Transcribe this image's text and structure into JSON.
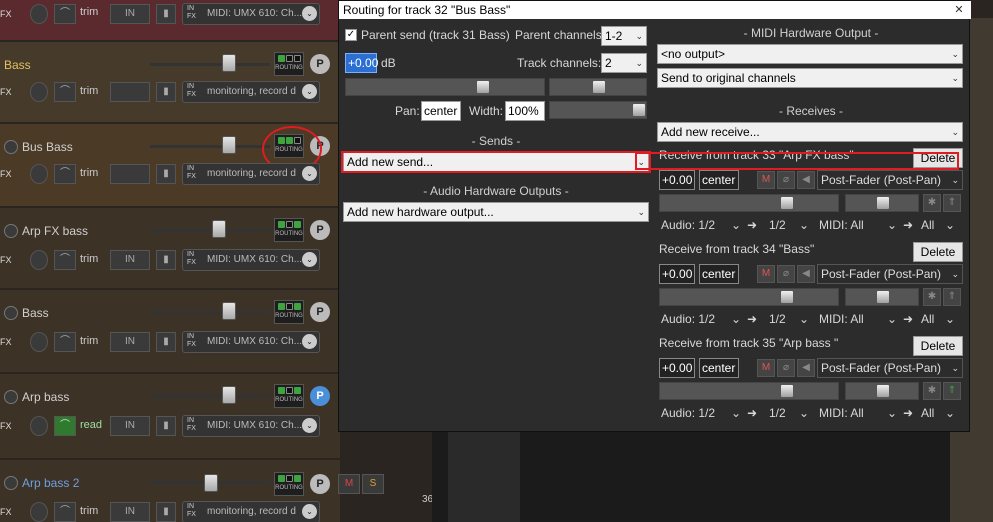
{
  "tracks": [
    {
      "name": "",
      "fx": "FX",
      "trim": "trim",
      "in": "IN",
      "midi": "MIDI: UMX 610: Ch..."
    },
    {
      "name": "Bass",
      "fx": "FX",
      "trim": "trim",
      "in": "IN",
      "midi": "monitoring, record d"
    },
    {
      "name": "Bus Bass",
      "fx": "FX",
      "trim": "trim",
      "in": "IN",
      "midi": "monitoring, record d"
    },
    {
      "name": "Arp FX bass",
      "fx": "FX",
      "trim": "trim",
      "in": "IN",
      "midi": "MIDI: UMX 610: Ch..."
    },
    {
      "name": "Bass",
      "fx": "FX",
      "trim": "trim",
      "in": "IN",
      "midi": "MIDI: UMX 610: Ch..."
    },
    {
      "name": "Arp bass",
      "fx": "FX",
      "trim": "read",
      "in": "IN",
      "midi": "MIDI: UMX 610: Ch..."
    },
    {
      "name": "Arp bass 2",
      "fx": "FX",
      "trim": "trim",
      "in": "IN",
      "midi": "monitoring, record d"
    }
  ],
  "common": {
    "routing": "ROUTING",
    "p": "P",
    "in_fx": "IN\nFX",
    "m": "M",
    "s": "S",
    "track_number": "36"
  },
  "dialog": {
    "title": "Routing for track 32 \"Bus Bass\"",
    "close": "✕",
    "parent_send_label": "Parent send (track 31 Bass)",
    "parent_channels_label": "Parent channels:",
    "parent_channels_value": "1-2",
    "volume_value": "+0.00",
    "db_label": "dB",
    "track_channels_label": "Track channels:",
    "track_channels_value": "2",
    "pan_label": "Pan:",
    "pan_value": "center",
    "width_label": "Width:",
    "width_value": "100%",
    "sends_header": "- Sends -",
    "add_new_send": "Add new send...",
    "audio_hw_header": "- Audio Hardware Outputs -",
    "add_new_hw": "Add new hardware output...",
    "midi_hw_header": "- MIDI Hardware Output -",
    "midi_output": "<no output>",
    "midi_channels": "Send to original channels",
    "receives_header": "- Receives -",
    "add_new_receive": "Add new receive...",
    "receives": [
      {
        "label": "Receive from track 33 \"Arp FX bass\"",
        "volume": "+0.00",
        "pan": "center",
        "mode": "Post-Fader (Post-Pan)",
        "audio": "Audio: 1/2",
        "audio_dest": "1/2",
        "midi": "MIDI: All",
        "midi_dest": "All",
        "delete": "Delete"
      },
      {
        "label": "Receive from track 34 \"Bass\"",
        "volume": "+0.00",
        "pan": "center",
        "mode": "Post-Fader (Post-Pan)",
        "audio": "Audio: 1/2",
        "audio_dest": "1/2",
        "midi": "MIDI: All",
        "midi_dest": "All",
        "delete": "Delete"
      },
      {
        "label": "Receive from track 35 \"Arp bass \"",
        "volume": "+0.00",
        "pan": "center",
        "mode": "Post-Fader (Post-Pan)",
        "audio": "Audio: 1/2",
        "audio_dest": "1/2",
        "midi": "MIDI: All",
        "midi_dest": "All",
        "delete": "Delete"
      }
    ]
  },
  "colors": {
    "accent_red": "#e01b24",
    "routing_green": "#3fa33f",
    "selected_blue": "#2a6fd1"
  }
}
